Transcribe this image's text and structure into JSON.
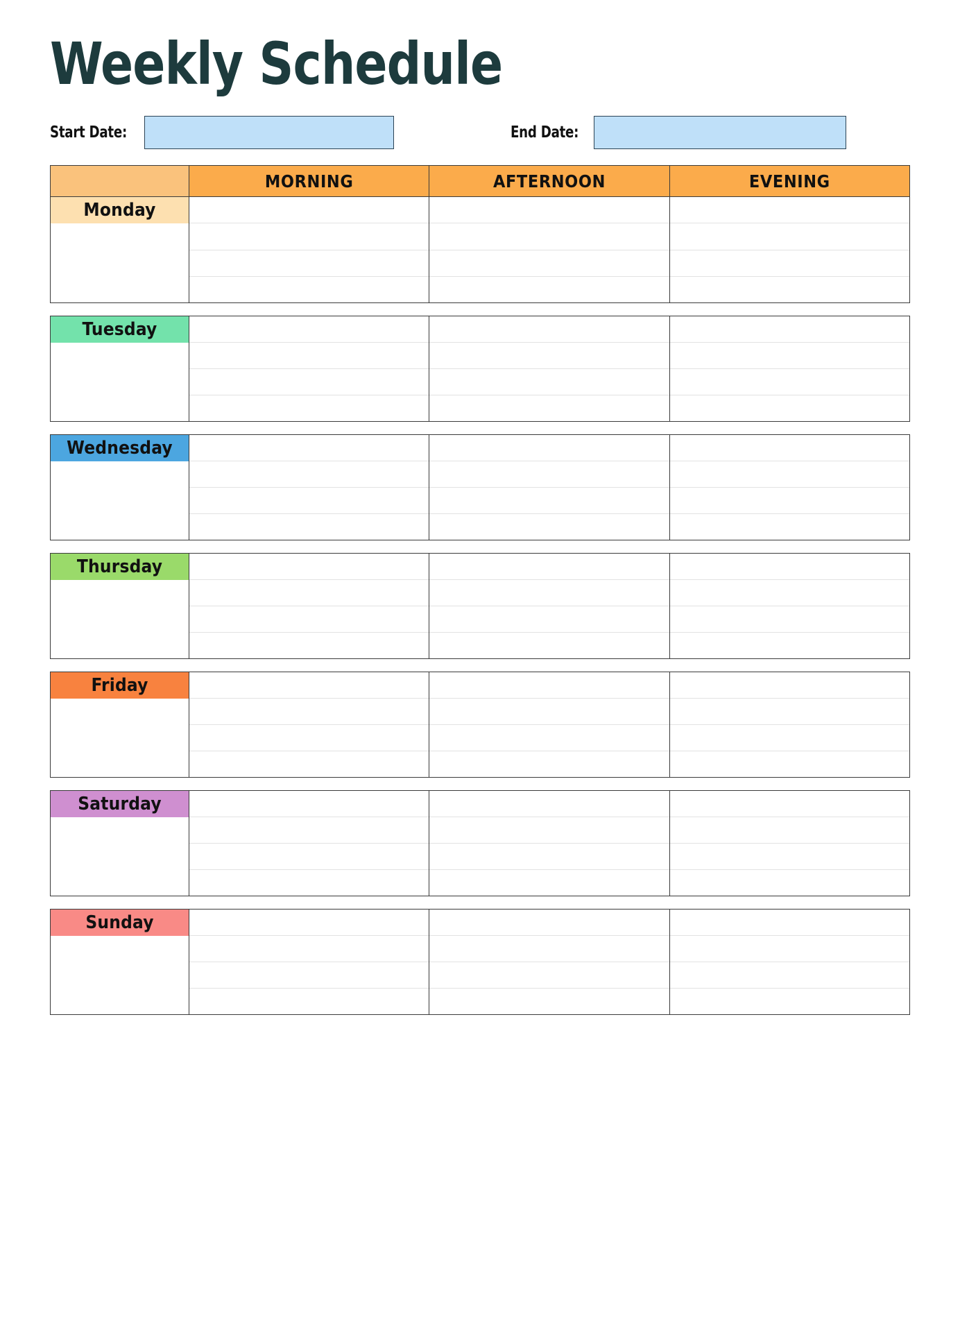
{
  "page": {
    "title": "Weekly Schedule",
    "title_color": "#1d3b3d",
    "background": "#ffffff"
  },
  "dates": {
    "start_label": "Start Date:",
    "start_value": "",
    "start_placeholder": "",
    "end_label": "End Date:",
    "end_value": "",
    "end_placeholder": "",
    "field_fill": "#bfe0f9",
    "field_border": "#2b4254"
  },
  "table": {
    "corner_header": "",
    "corner_fill": "#fac27c",
    "header_fill": "#fbab4b",
    "columns": [
      {
        "label": "MORNING"
      },
      {
        "label": "AFTERNOON"
      },
      {
        "label": "EVENING"
      }
    ],
    "rows_per_day": 4,
    "days": [
      {
        "label": "Monday",
        "color": "#fde0b0"
      },
      {
        "label": "Tuesday",
        "color": "#73e2ab"
      },
      {
        "label": "Wednesday",
        "color": "#4ca6e0"
      },
      {
        "label": "Thursday",
        "color": "#9ada6a"
      },
      {
        "label": "Friday",
        "color": "#f8823f"
      },
      {
        "label": "Saturday",
        "color": "#cf8fd0"
      },
      {
        "label": "Sunday",
        "color": "#f98a86"
      }
    ]
  }
}
